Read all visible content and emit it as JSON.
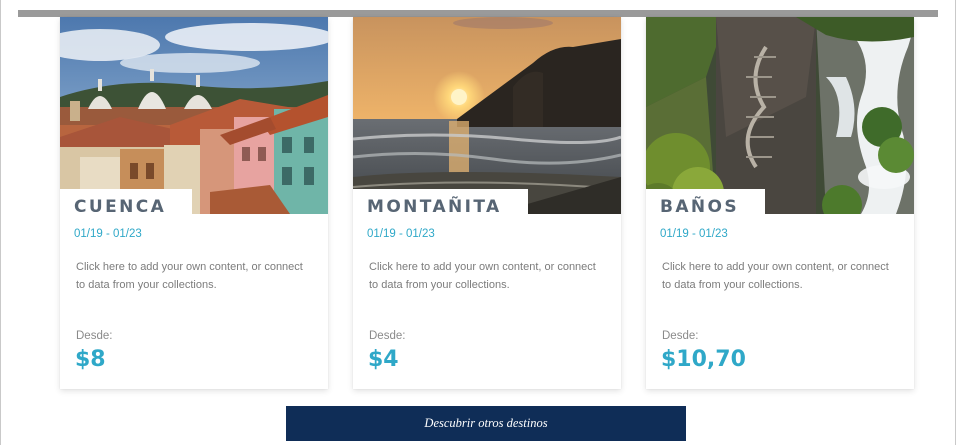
{
  "destinations": [
    {
      "name": "CUENCA",
      "dates": "01/19 - 01/23",
      "description": "Click here to add your own content, or connect to data from your collections.",
      "from_label": "Desde:",
      "price": "$8",
      "image": "cuenca-cathedral-city-photo"
    },
    {
      "name": "MONTAÑITA",
      "dates": "01/19 - 01/23",
      "description": "Click here to add your own content, or connect to data from your collections.",
      "from_label": "Desde:",
      "price": "$4",
      "image": "montanita-beach-sunset-photo"
    },
    {
      "name": "BAÑOS",
      "dates": "01/19 - 01/23",
      "description": "Click here to add your own content, or connect to data from your collections.",
      "from_label": "Desde:",
      "price": "$10,70",
      "image": "banos-waterfall-photo"
    }
  ],
  "cta": {
    "label": "Descubrir otros destinos"
  },
  "colors": {
    "accent": "#2fa8c8",
    "title": "#576574",
    "button": "#0f2d57"
  }
}
